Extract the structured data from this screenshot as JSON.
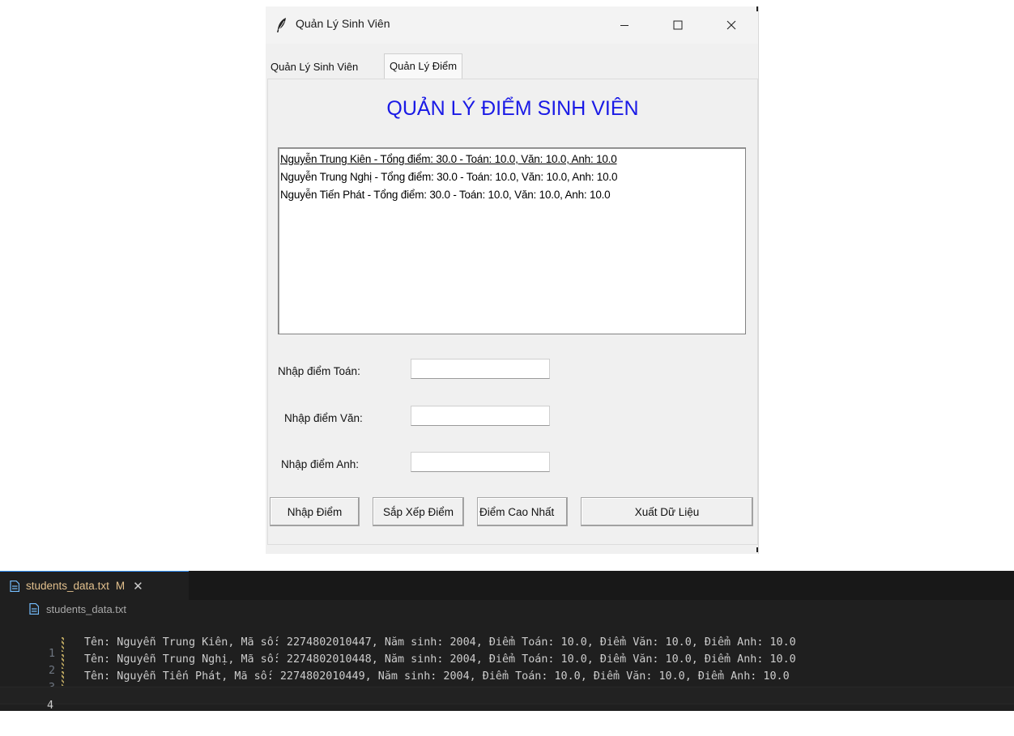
{
  "window": {
    "title": "Quản Lý Sinh Viên",
    "controls": {
      "minimize": "—",
      "maximize": "☐",
      "close": "✕"
    },
    "tabs": [
      "Quản Lý Sinh Viên",
      "Quản Lý Điểm"
    ],
    "active_tab": "Quản Lý Điểm"
  },
  "panel": {
    "heading": "QUẢN LÝ ĐIỂM SINH VIÊN",
    "list_items": [
      "Nguyễn Trung Kiên - Tổng điểm: 30.0 - Toán: 10.0, Văn: 10.0, Anh: 10.0",
      "Nguyễn Trung Nghị - Tổng điểm: 30.0 - Toán: 10.0, Văn: 10.0, Anh: 10.0",
      "Nguyễn Tiến Phát - Tổng điểm: 30.0 - Toán: 10.0, Văn: 10.0, Anh: 10.0"
    ],
    "fields": {
      "toan_label": "Nhập điểm Toán:",
      "toan_value": "",
      "van_label": "Nhập điểm Văn:",
      "van_value": "",
      "anh_label": "Nhập điểm Anh:",
      "anh_value": ""
    },
    "buttons": {
      "nhap_diem": "Nhập Điểm",
      "sap_xep": "Sắp Xếp Điểm",
      "cao_nhat": "Điểm Cao Nhất",
      "xuat": "Xuất Dữ Liệu"
    }
  },
  "editor": {
    "tab_name": "students_data.txt",
    "tab_status": "M",
    "tab_close": "✕",
    "breadcrumb": "students_data.txt",
    "lines": [
      {
        "num": "1",
        "text": "Tên: Nguyễn Trung Kiên, Mã số: 2274802010447, Năm sinh: 2004, Điểm Toán: 10.0, Điểm Văn: 10.0, Điểm Anh: 10.0"
      },
      {
        "num": "2",
        "text": "Tên: Nguyễn Trung Nghị, Mã số: 2274802010448, Năm sinh: 2004, Điểm Toán: 10.0, Điểm Văn: 10.0, Điểm Anh: 10.0"
      },
      {
        "num": "3",
        "text": "Tên: Nguyễn Tiến Phát, Mã số: 2274802010449, Năm sinh: 2004, Điểm Toán: 10.0, Điểm Văn: 10.0, Điểm Anh: 10.0"
      },
      {
        "num": "4",
        "text": ""
      }
    ]
  },
  "colors": {
    "heading": "#1a1ae6",
    "editor_bg": "#1f1f1f",
    "modified": "#e2c08d",
    "tab_accent": "#3794ff"
  }
}
